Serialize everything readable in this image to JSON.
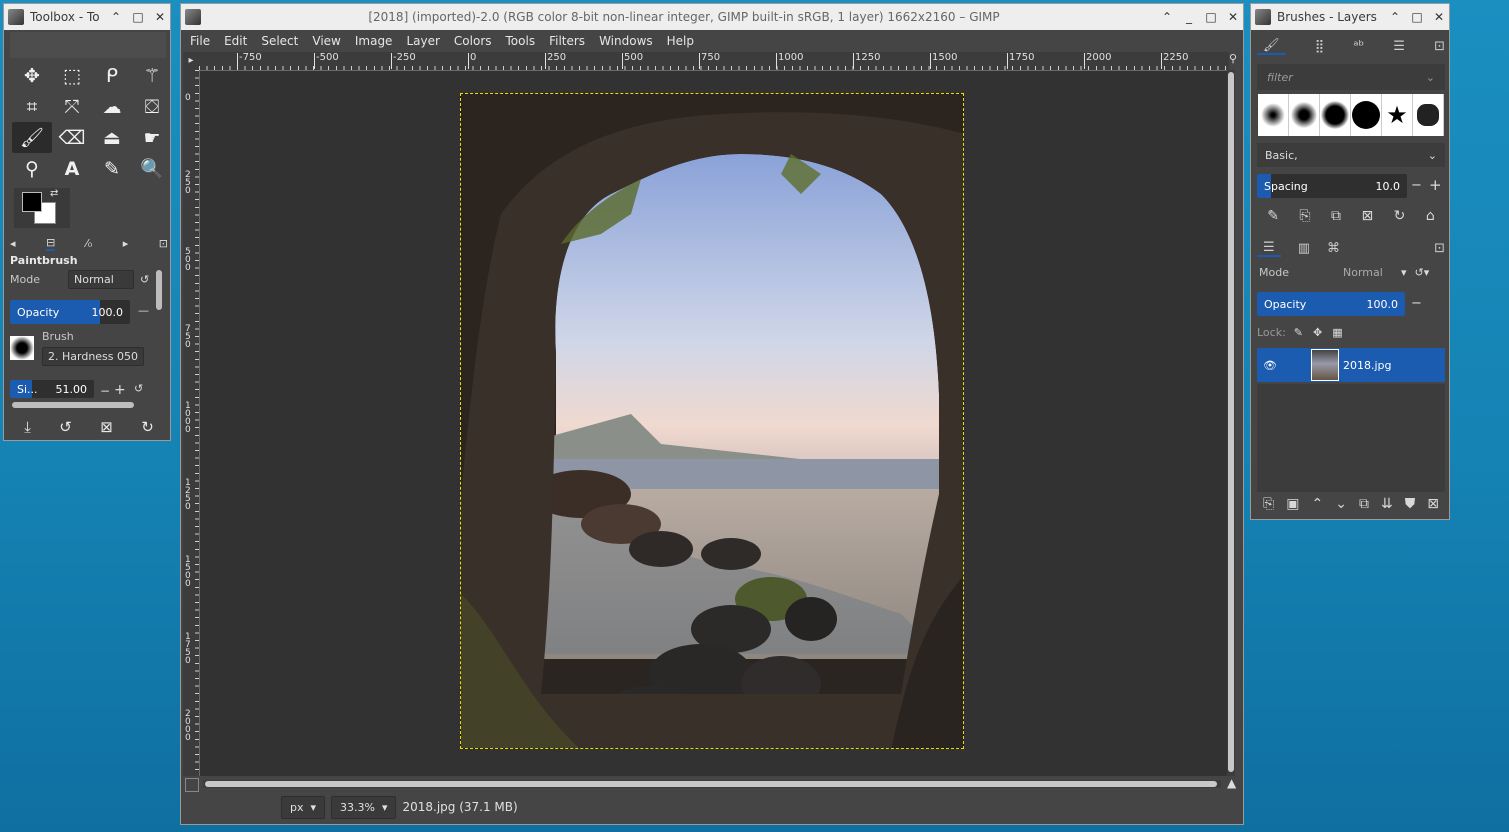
{
  "toolbox": {
    "title": "Toolbox - To",
    "tools": [
      "move-icon",
      "rect-select-icon",
      "lasso-icon",
      "fuzzy-select-icon",
      "crop-icon",
      "transform-icon",
      "warp-icon",
      "bucket-fill-icon",
      "paintbrush-icon",
      "eraser-icon",
      "clone-icon",
      "smudge-icon",
      "path-icon",
      "text-icon",
      "color-picker-icon",
      "zoom-icon"
    ],
    "tool_options_title": "Paintbrush",
    "mode_label": "Mode",
    "mode_value": "Normal",
    "opacity_label": "Opacity",
    "opacity_value": "100.0",
    "opacity_fraction": 0.75,
    "brush_label": "Brush",
    "brush_name": "2. Hardness 050",
    "size_label": "Si...",
    "size_value": "51.00"
  },
  "main": {
    "title": "[2018] (imported)-2.0 (RGB color 8-bit non-linear integer, GIMP built-in sRGB, 1 layer) 1662x2160 – GIMP",
    "menus": [
      "File",
      "Edit",
      "Select",
      "View",
      "Image",
      "Layer",
      "Colors",
      "Tools",
      "Filters",
      "Windows",
      "Help"
    ],
    "hruler_labels": [
      "-750",
      "-500",
      "-250",
      "0",
      "250",
      "500",
      "750",
      "1000",
      "1250",
      "1500",
      "1750",
      "2000",
      "2250"
    ],
    "vruler_labels": [
      "0",
      "250",
      "500",
      "750",
      "1000",
      "1250",
      "1500",
      "1750",
      "2000"
    ],
    "unit": "px",
    "zoom": "33.3%",
    "status": "2018.jpg (37.1 MB)"
  },
  "dock": {
    "title": "Brushes - Layers",
    "filter_placeholder": "filter",
    "brush_tag": "Basic,",
    "spacing_label": "Spacing",
    "spacing_value": "10.0",
    "layers_mode_label": "Mode",
    "layers_mode_value": "Normal",
    "layers_opacity_label": "Opacity",
    "layers_opacity_value": "100.0",
    "lock_label": "Lock:",
    "layer_name": "2018.jpg"
  },
  "colors": {
    "accent": "#1b5bb0",
    "selection": "#e8e000"
  }
}
